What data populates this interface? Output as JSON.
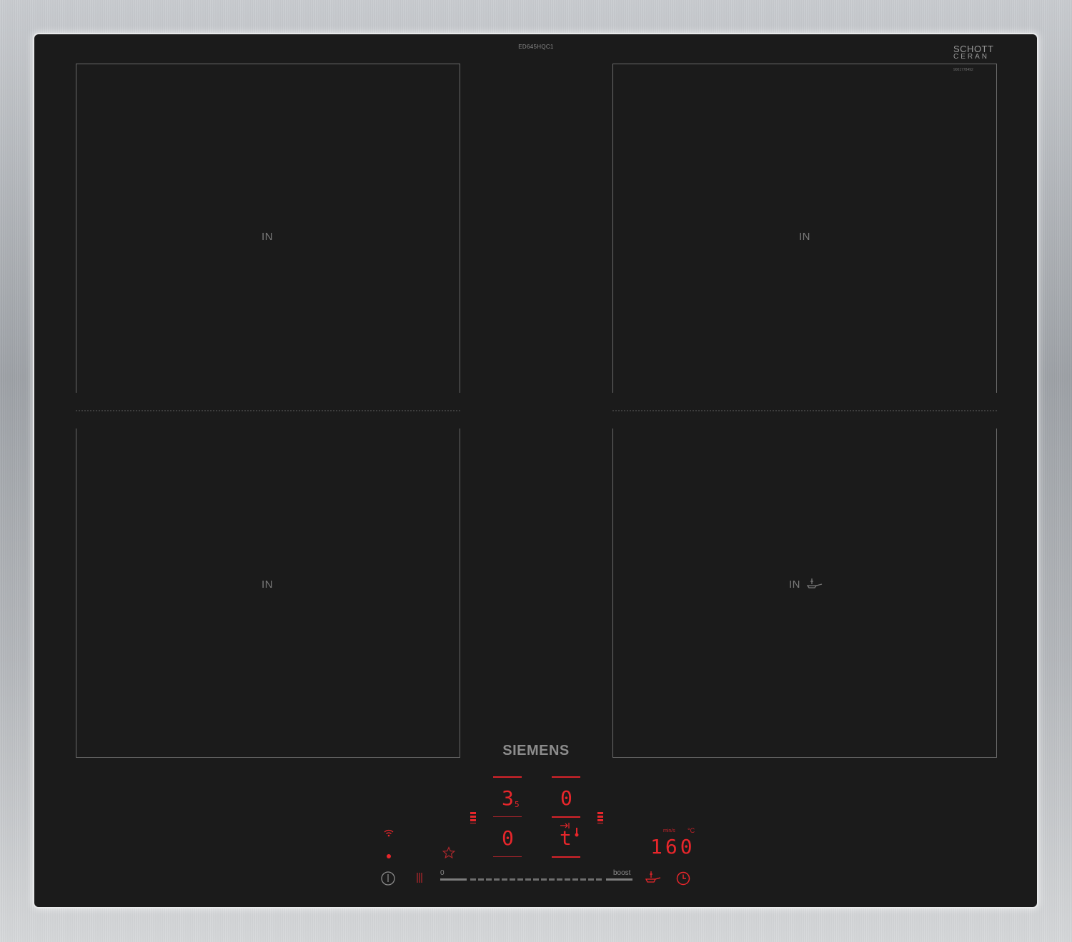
{
  "hob": {
    "model": "ED645HQC1",
    "glass_brand_line1": "SCHOTT",
    "glass_brand_line2": "CERAN",
    "serial": "9001778492",
    "brand": "SIEMENS",
    "zones": {
      "top_left": "IN",
      "top_right": "IN",
      "bottom_left": "IN",
      "bottom_right": "IN"
    }
  },
  "display": {
    "zone_front_left_level": "3",
    "zone_front_left_level_fraction": "5",
    "zone_front_right_level": "0",
    "zone_rear_left_level": "0",
    "zone_rear_right_symbol": "t",
    "temperature": "160",
    "temp_unit": "°C",
    "temp_mode_label": "min/s"
  },
  "controls": {
    "slider_min_label": "0",
    "slider_max_label": "boost",
    "icons": [
      "wifi-icon",
      "power-icon",
      "lock-icon",
      "favorite-icon",
      "frying-sensor-icon",
      "timer-icon"
    ]
  },
  "colors": {
    "glass": "#1b1b1b",
    "led_red": "#e8262b",
    "frame": "#b4b7bb"
  }
}
